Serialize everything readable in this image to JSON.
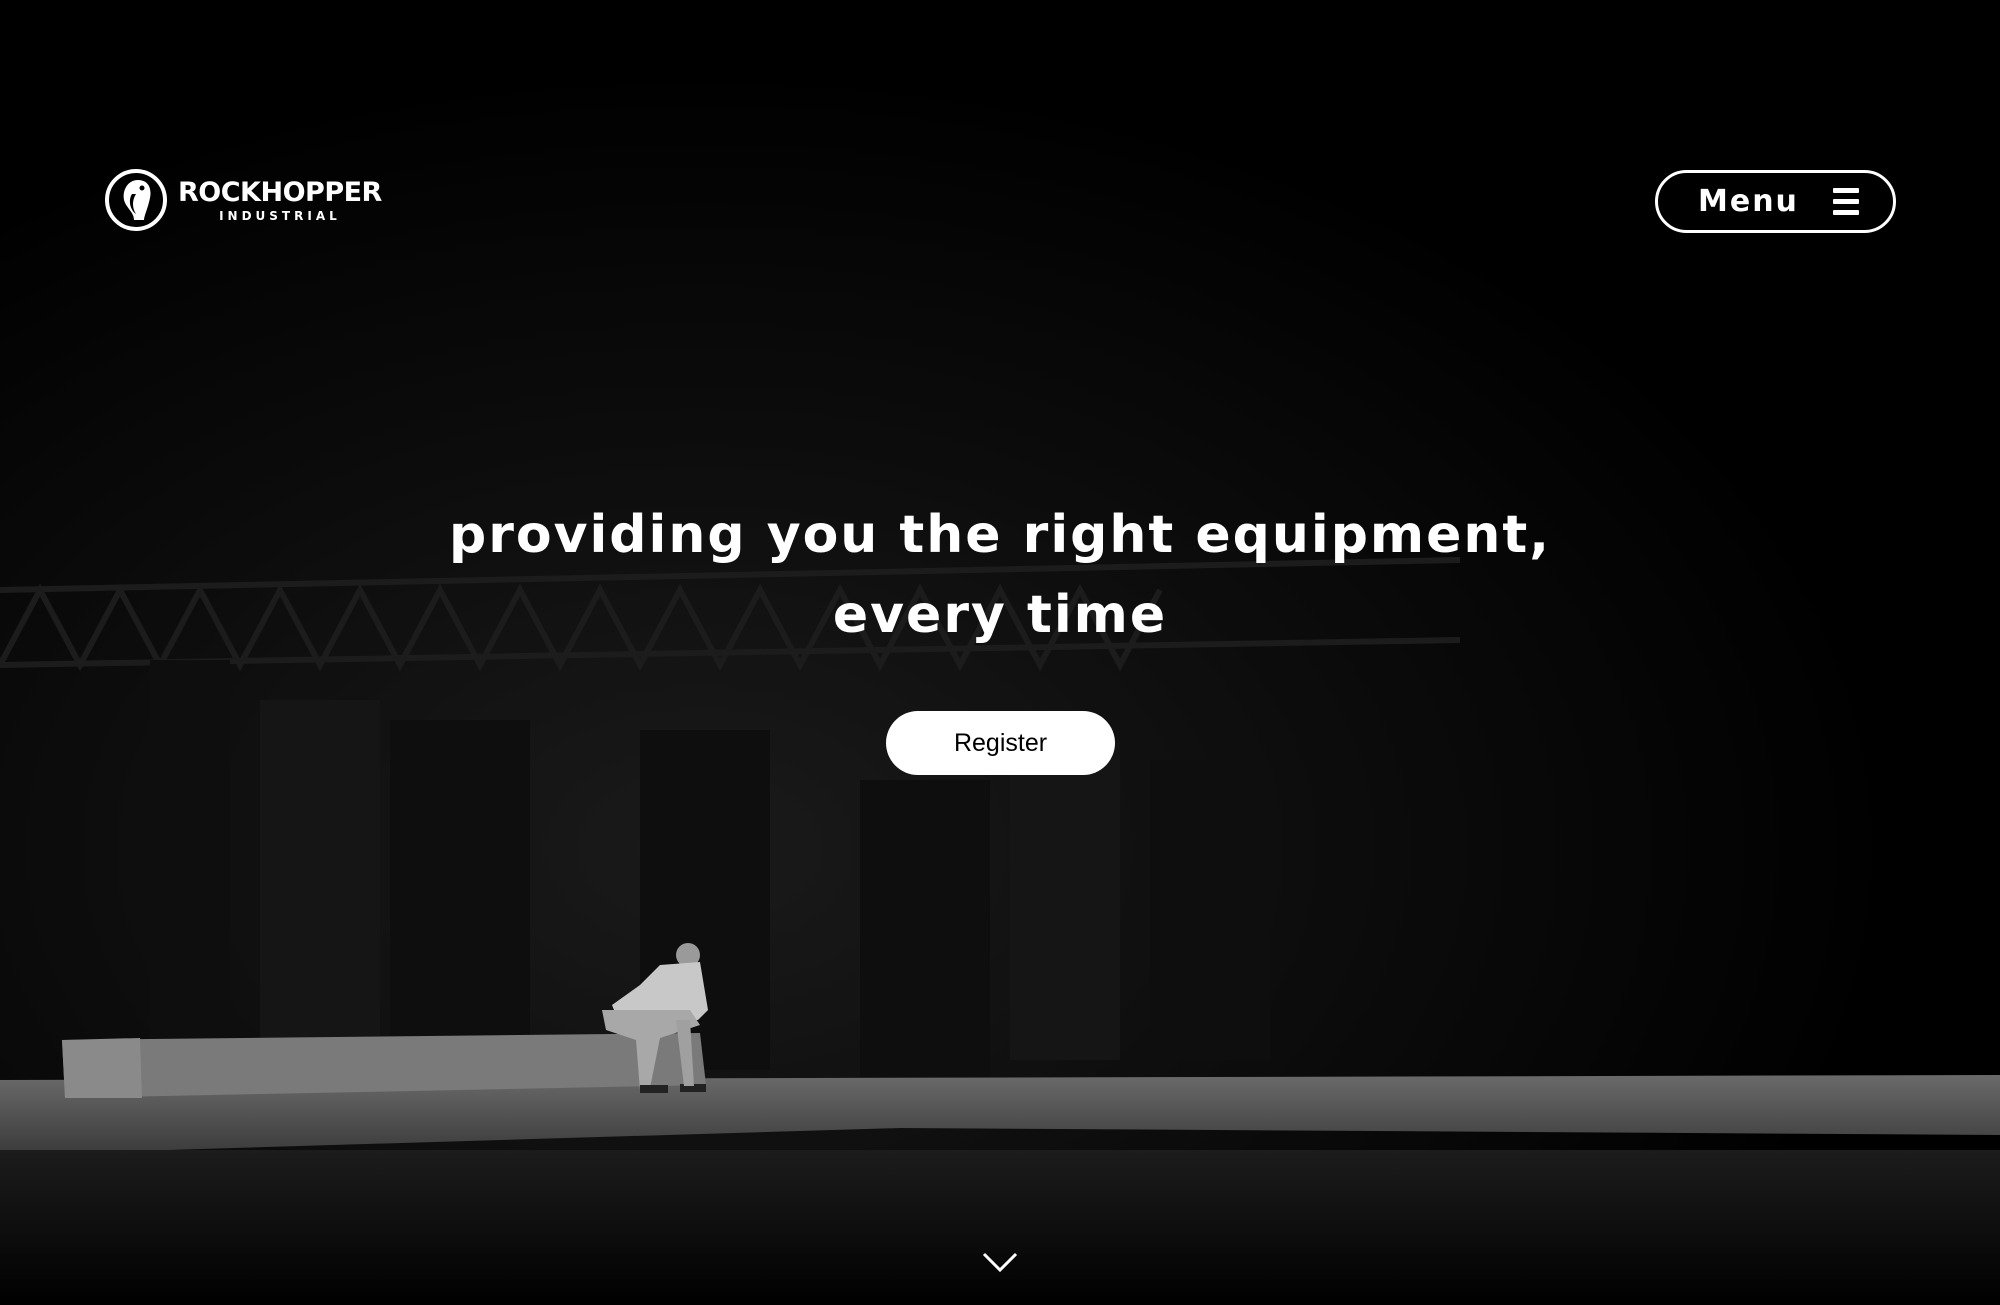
{
  "brand": {
    "name": "ROCKHOPPER",
    "subtitle": "INDUSTRIAL"
  },
  "header": {
    "menu_label": "Menu",
    "menu_icon": "hamburger-icon"
  },
  "hero": {
    "headline_line1": "providing you the right equipment,",
    "headline_line2": "every time",
    "cta_label": "Register",
    "background_image": "black-and-white photo of a man sitting on a concrete bench in a dark hall",
    "scroll_icon": "chevron-down-icon"
  },
  "colors": {
    "background": "#000000",
    "foreground": "#ffffff",
    "button_text": "#000000"
  }
}
